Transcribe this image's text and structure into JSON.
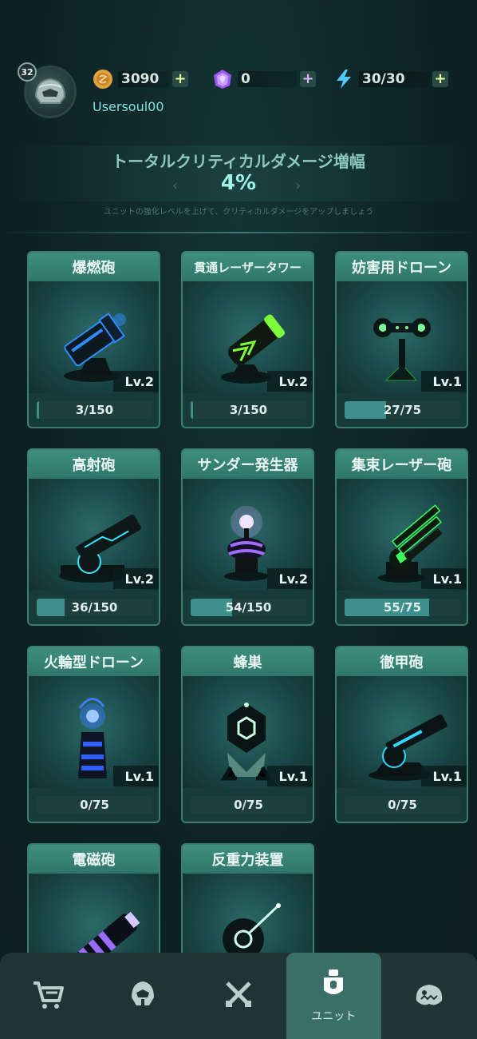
{
  "player": {
    "level": "32",
    "username": "Usersoul00"
  },
  "resources": {
    "coins": "3090",
    "gems": "0",
    "energy": "30/30"
  },
  "critical": {
    "title": "トータルクリティカルダメージ増幅",
    "value": "4%",
    "subtitle": "ユニットの強化レベルを上げて、クリティカルダメージをアップしましょう"
  },
  "units": [
    {
      "name": "爆燃砲",
      "level": "Lv.2",
      "progress_text": "3/150",
      "progress": 0.02,
      "accent": "#2f8cff"
    },
    {
      "name": "貫通レーザータワー",
      "level": "Lv.2",
      "progress_text": "3/150",
      "progress": 0.02,
      "accent": "#7cff3a"
    },
    {
      "name": "妨害用ドローン",
      "level": "Lv.1",
      "progress_text": "27/75",
      "progress": 0.36,
      "accent": "#7cff9a"
    },
    {
      "name": "高射砲",
      "level": "Lv.2",
      "progress_text": "36/150",
      "progress": 0.24,
      "accent": "#2fe6ff"
    },
    {
      "name": "サンダー発生器",
      "level": "Lv.2",
      "progress_text": "54/150",
      "progress": 0.36,
      "accent": "#a06bff"
    },
    {
      "name": "集束レーザー砲",
      "level": "Lv.1",
      "progress_text": "55/75",
      "progress": 0.73,
      "accent": "#3aff5a"
    },
    {
      "name": "火輪型ドローン",
      "level": "Lv.1",
      "progress_text": "0/75",
      "progress": 0,
      "accent": "#3a7dff"
    },
    {
      "name": "蜂巣",
      "level": "Lv.1",
      "progress_text": "0/75",
      "progress": 0,
      "accent": "#c8ffe0"
    },
    {
      "name": "徹甲砲",
      "level": "Lv.1",
      "progress_text": "0/75",
      "progress": 0,
      "accent": "#2fd6ff"
    },
    {
      "name": "電磁砲",
      "level": "",
      "progress_text": "",
      "progress": 0,
      "accent": "#9a6bff"
    },
    {
      "name": "反重力装置",
      "level": "",
      "progress_text": "",
      "progress": 0,
      "accent": "#d0fff4"
    }
  ],
  "nav": {
    "items": [
      {
        "icon": "cart-icon",
        "label": ""
      },
      {
        "icon": "helmet-icon",
        "label": ""
      },
      {
        "icon": "crossed-swords-icon",
        "label": ""
      },
      {
        "icon": "unit-icon",
        "label": "ユニット"
      },
      {
        "icon": "monster-icon",
        "label": ""
      }
    ],
    "active": 3
  }
}
